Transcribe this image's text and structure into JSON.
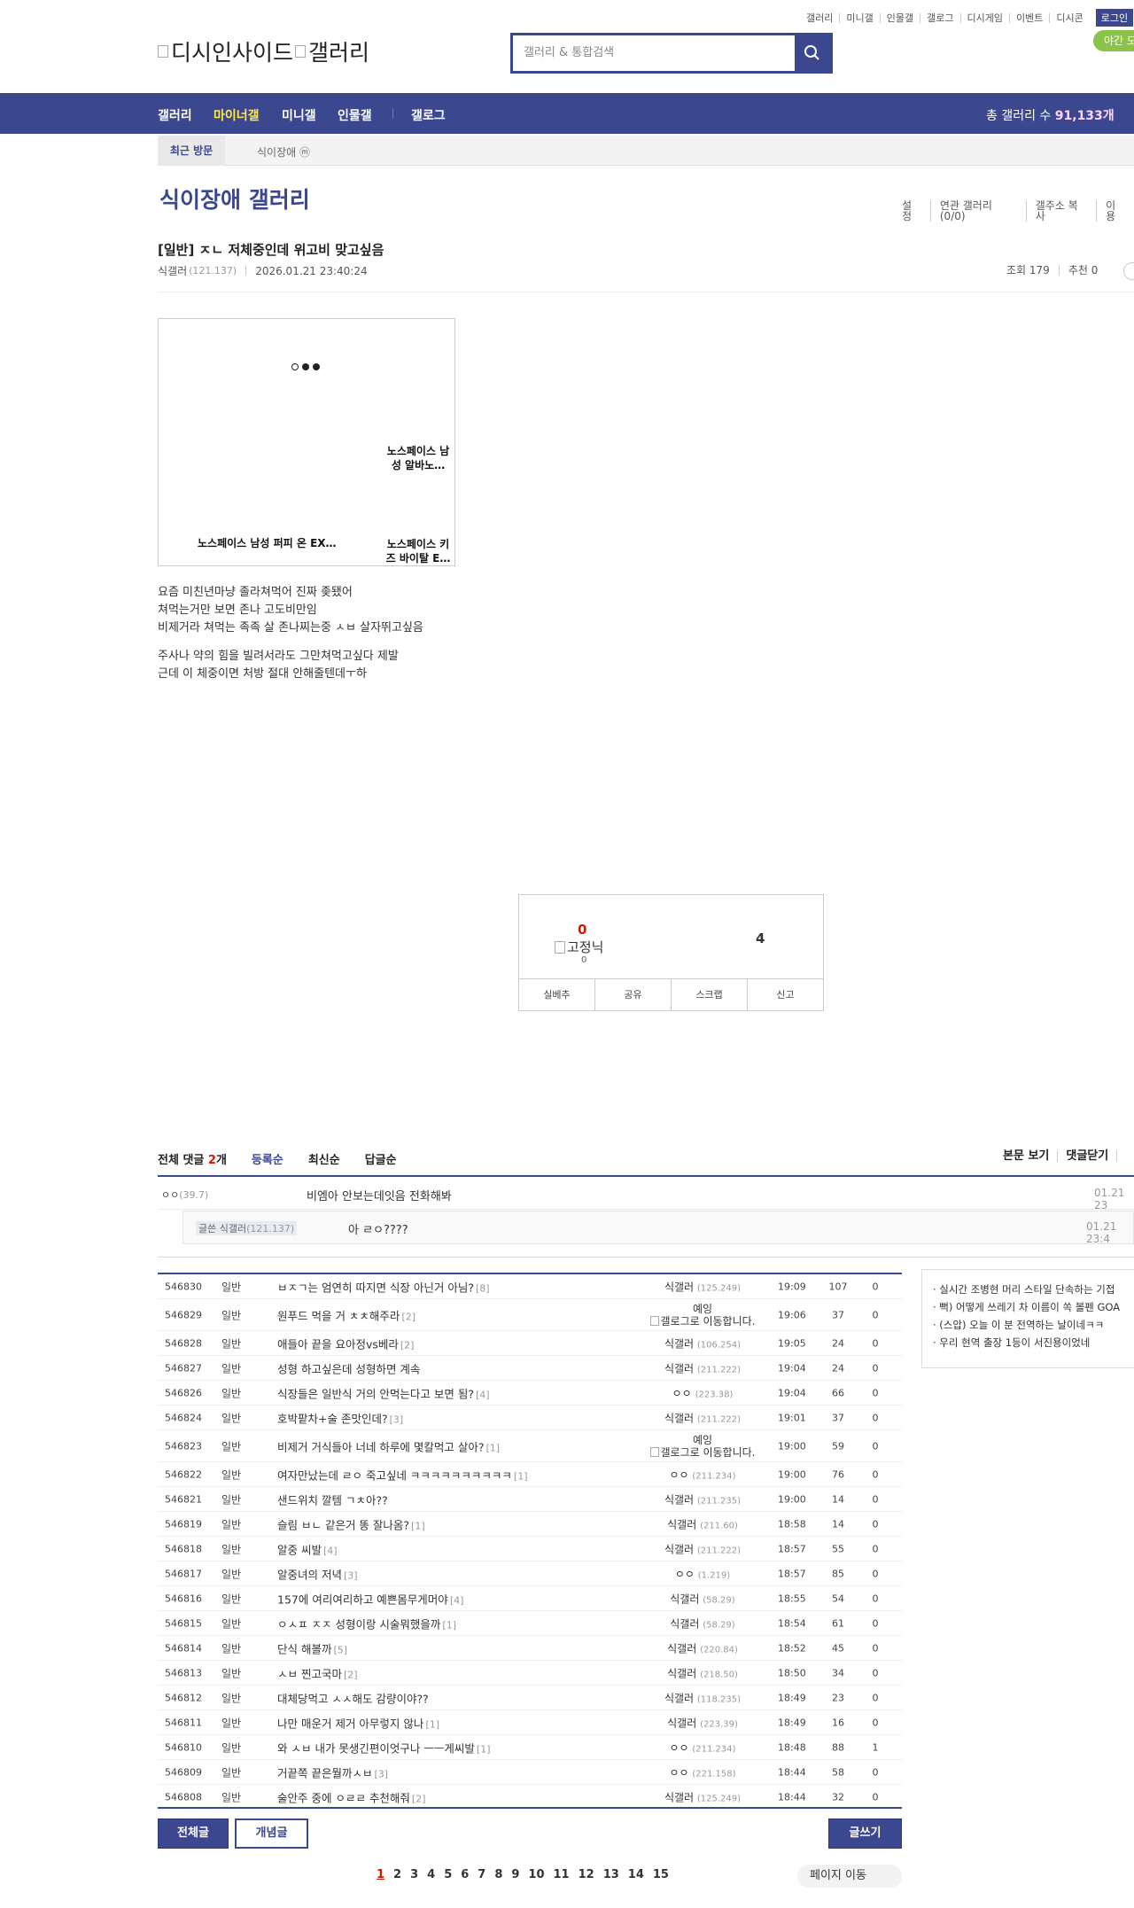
{
  "top_links": [
    "갤러리",
    "미니갤",
    "인물갤",
    "갤로그",
    "디시게임",
    "이벤트",
    "디시콘"
  ],
  "login_label": "로그인",
  "night_label": "야간 모",
  "logo_text": "디시인사이드",
  "logo_gallery_text": "갤러리",
  "search_placeholder": "갤러리 & 통합검색",
  "nav": {
    "items": [
      "갤러리",
      "마이너갤",
      "미니갤",
      "인물갤",
      "갤로그"
    ],
    "total_label": "총 갤러리 수",
    "total_value": "91,133개"
  },
  "recent": {
    "label": "최근 방문",
    "gallery": "식이장애 ⓜ"
  },
  "gallery_title": "식이장애 갤러리",
  "gallery_tools": [
    "설정",
    "연관 갤러리(0/0)",
    "갤주소 복사",
    "이용"
  ],
  "post": {
    "title": "[일반] ㅈㄴ 저체중인데 위고비 맞고싶음",
    "author": "식갤러",
    "ip": "(121.137)",
    "date": "2026.01.21 23:40:24",
    "views": "조회 179",
    "recommends": "추천 0",
    "video": {
      "rec1": "노스페이스 남성 알바노…",
      "rec2": "노스페이스 남성 퍼피 온 EX…",
      "rec3": "노스페이스 키즈 바이탈 E…"
    },
    "body": [
      [
        "요즘 미친년마냥 졸라쳐먹어 진짜 좆됐어",
        "쳐먹는거만 보면 존나 고도비만임",
        "비제거라 쳐먹는 족족 살 존나찌는중 ㅅㅂ 살자뛰고싶음"
      ],
      [
        "주사나 약의 힘을 빌려서라도 그만쳐먹고싶다 제발",
        "근데 이 체중이면 처방 절대 안해줄텐데ㅜ하"
      ]
    ]
  },
  "recommend_box": {
    "up": "0",
    "fixed_label": "고정닉",
    "fixed_count": "0",
    "down": "4",
    "buttons": [
      "실베추",
      "공유",
      "스크랩",
      "신고"
    ]
  },
  "comments": {
    "label": "전체 댓글",
    "count": "2",
    "unit": "개",
    "sorts": [
      "등록순",
      "최신순",
      "답글순"
    ],
    "right": [
      "본문 보기",
      "댓글닫기"
    ],
    "items": [
      {
        "name": "ㅇㅇ",
        "ip": "(39.7)",
        "text": "비엠아 안보는데잇음 전화해봐",
        "time": "01.21 23"
      },
      {
        "name": "글쓴 식갤러",
        "ip": "(121.137)",
        "text": "아 ㄹㅇ????",
        "time": "01.21 23:4"
      }
    ]
  },
  "posts": [
    {
      "num": "546830",
      "head": "일반",
      "title": "ㅂㅈㄱ는 엄연히 따지면 식장 아닌거 아님?",
      "replies": "[8]",
      "writer": "식갤러",
      "ip": "(125.249)",
      "date": "19:09",
      "views": "107",
      "rec": "0"
    },
    {
      "num": "546829",
      "head": "일반",
      "title": "원푸드 먹을 거 ㅊㅊ해주라",
      "replies": "[2]",
      "writer": "예잉",
      "writer2": "갤로그로 이동합니다.",
      "date": "19:06",
      "views": "37",
      "rec": "0"
    },
    {
      "num": "546828",
      "head": "일반",
      "title": "애들아 끝을 요아정vs베라",
      "replies": "[2]",
      "writer": "식갤러",
      "ip": "(106.254)",
      "date": "19:05",
      "views": "24",
      "rec": "0"
    },
    {
      "num": "546827",
      "head": "일반",
      "title": "성형 하고싶은데 성형하면 계속",
      "replies": "",
      "writer": "식갤러",
      "ip": "(211.222)",
      "date": "19:04",
      "views": "24",
      "rec": "0"
    },
    {
      "num": "546826",
      "head": "일반",
      "title": "식장들은 일반식 거의 안먹는다고 보면 됨?",
      "replies": "[4]",
      "writer": "ㅇㅇ",
      "ip": "(223.38)",
      "date": "19:04",
      "views": "66",
      "rec": "0"
    },
    {
      "num": "546824",
      "head": "일반",
      "title": "호박팥차+술 존맛인데?",
      "replies": "[3]",
      "writer": "식갤러",
      "ip": "(211.222)",
      "date": "19:01",
      "views": "37",
      "rec": "0"
    },
    {
      "num": "546823",
      "head": "일반",
      "title": "비제거 거식들아 너네 하루에 몇칼먹고 살아?",
      "replies": "[1]",
      "writer": "예잉",
      "writer2": "갤로그로 이동합니다.",
      "date": "19:00",
      "views": "59",
      "rec": "0"
    },
    {
      "num": "546822",
      "head": "일반",
      "title": "여자만났는데 ㄹㅇ 죽고싶네 ㅋㅋㅋㅋㅋㅋㅋㅋㅋㅋ",
      "replies": "[1]",
      "writer": "ㅇㅇ",
      "ip": "(211.234)",
      "date": "19:00",
      "views": "76",
      "rec": "0"
    },
    {
      "num": "546821",
      "head": "일반",
      "title": "샌드위치 깔템 ㄱㅊ아??",
      "replies": "",
      "writer": "식갤러",
      "ip": "(211.235)",
      "date": "19:00",
      "views": "14",
      "rec": "0"
    },
    {
      "num": "546819",
      "head": "일반",
      "title": "슬림 ㅂㄴ 같은거 똥 잘나옴?",
      "replies": "[1]",
      "writer": "식갤러",
      "ip": "(211.60)",
      "date": "18:58",
      "views": "14",
      "rec": "0"
    },
    {
      "num": "546818",
      "head": "일반",
      "title": "알중 씨발",
      "replies": "[4]",
      "writer": "식갤러",
      "ip": "(211.222)",
      "date": "18:57",
      "views": "55",
      "rec": "0"
    },
    {
      "num": "546817",
      "head": "일반",
      "title": "알중녀의 저녁",
      "replies": "[3]",
      "writer": "ㅇㅇ",
      "ip": "(1.219)",
      "date": "18:57",
      "views": "85",
      "rec": "0"
    },
    {
      "num": "546816",
      "head": "일반",
      "title": "157에 여리여리하고 예쁜몸무게머야",
      "replies": "[4]",
      "writer": "식갤러",
      "ip": "(58.29)",
      "date": "18:55",
      "views": "54",
      "rec": "0"
    },
    {
      "num": "546815",
      "head": "일반",
      "title": "ㅇㅅㅍ ㅈㅈ 성형이랑 시술뭐했을까",
      "replies": "[1]",
      "writer": "식갤러",
      "ip": "(58.29)",
      "date": "18:54",
      "views": "61",
      "rec": "0"
    },
    {
      "num": "546814",
      "head": "일반",
      "title": "단식 해볼까",
      "replies": "[5]",
      "writer": "식갤러",
      "ip": "(220.84)",
      "date": "18:52",
      "views": "45",
      "rec": "0"
    },
    {
      "num": "546813",
      "head": "일반",
      "title": "ㅅㅂ 찐고국마",
      "replies": "[2]",
      "writer": "식갤러",
      "ip": "(218.50)",
      "date": "18:50",
      "views": "34",
      "rec": "0"
    },
    {
      "num": "546812",
      "head": "일반",
      "title": "대체당먹고 ㅅㅅ해도 감량이야??",
      "replies": "",
      "writer": "식갤러",
      "ip": "(118.235)",
      "date": "18:49",
      "views": "23",
      "rec": "0"
    },
    {
      "num": "546811",
      "head": "일반",
      "title": "나만 매운거 제거 아무렇지 않나",
      "replies": "[1]",
      "writer": "식갤러",
      "ip": "(223.39)",
      "date": "18:49",
      "views": "16",
      "rec": "0"
    },
    {
      "num": "546810",
      "head": "일반",
      "title": "와 ㅅㅂ 내가 못생긴편이엇구나 ㅡㅡ게씨발",
      "replies": "[1]",
      "writer": "ㅇㅇ",
      "ip": "(211.234)",
      "date": "18:48",
      "views": "88",
      "rec": "1"
    },
    {
      "num": "546809",
      "head": "일반",
      "title": "거끝쪽 끝은뭘까ㅅㅂ",
      "replies": "[3]",
      "writer": "ㅇㅇ",
      "ip": "(221.158)",
      "date": "18:44",
      "views": "58",
      "rec": "0"
    },
    {
      "num": "546808",
      "head": "일반",
      "title": "술안주 중에 ㅇㄹㄹ 추천해줘",
      "replies": "[2]",
      "writer": "식갤러",
      "ip": "(125.249)",
      "date": "18:44",
      "views": "32",
      "rec": "0"
    }
  ],
  "side_news": [
    "· 실시간 조병현 머리 스타일 단속하는 기접",
    "· 뻑) 어떻게 쓰레기 차 이름이 쏙 볼펜 GOA",
    "· (스압) 오늘 이 분 전역하는 날이네ㅋㅋ",
    "· 우리 현역 출장 1등이 서진용이었네"
  ],
  "buttons": {
    "all": "전체글",
    "concept": "개념글",
    "write": "글쓰기"
  },
  "pages": [
    "1",
    "2",
    "3",
    "4",
    "5",
    "6",
    "7",
    "8",
    "9",
    "10",
    "11",
    "12",
    "13",
    "14",
    "15"
  ],
  "page_jump": "페이지 이동",
  "colors": {
    "primary": "#3b4890",
    "accent_yellow": "#ffe84d",
    "red": "#d31900",
    "night_green": "#8bc34a"
  }
}
